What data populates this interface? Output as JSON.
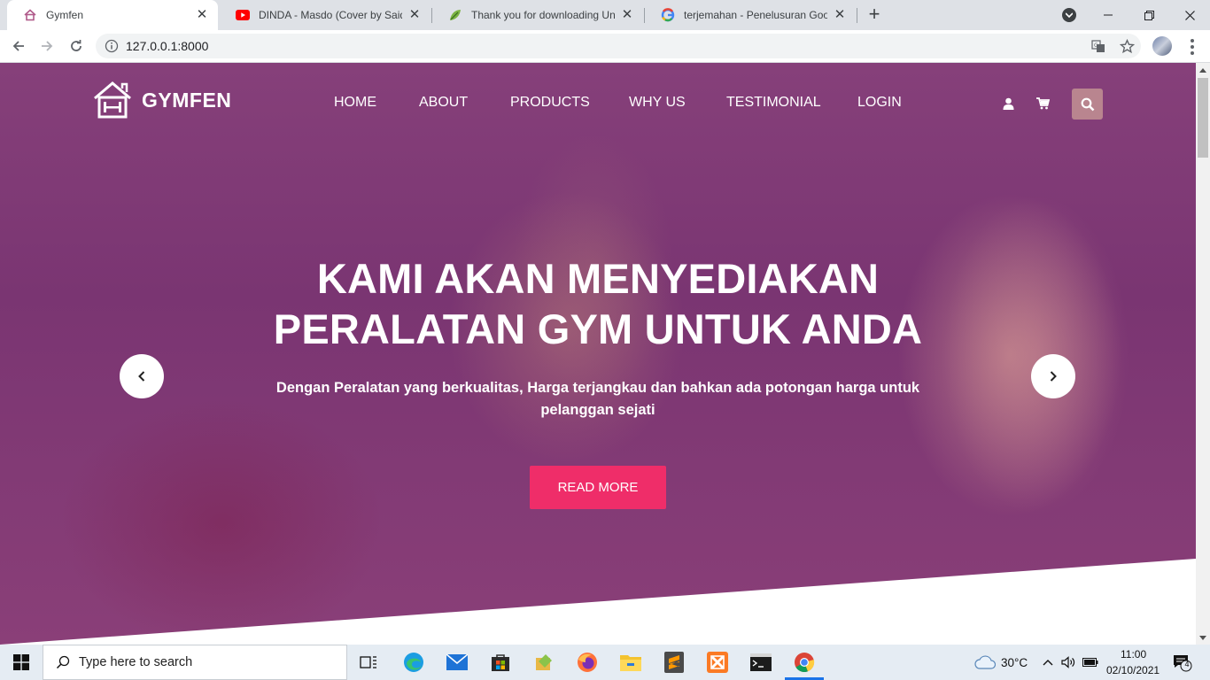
{
  "browser": {
    "tabs": [
      {
        "title": "Gymfen",
        "favicon": "house-icon",
        "active": true
      },
      {
        "title": "DINDA - Masdo (Cover by Saidah",
        "favicon": "youtube-icon",
        "active": false
      },
      {
        "title": "Thank you for downloading Unlo",
        "favicon": "leaf-icon",
        "active": false
      },
      {
        "title": "terjemahan - Penelusuran Google",
        "favicon": "google-icon",
        "active": false
      }
    ],
    "new_tab_label": "+",
    "url": "127.0.0.1:8000"
  },
  "site": {
    "brand": "GYMFEN",
    "nav": [
      "HOME",
      "ABOUT",
      "PRODUCTS",
      "WHY US",
      "TESTIMONIAL",
      "LOGIN"
    ],
    "hero": {
      "title_line1": "KAMI AKAN MENYEDIAKAN",
      "title_line2": "PERALATAN GYM UNTUK ANDA",
      "subtitle": "Dengan Peralatan yang berkualitas, Harga terjangkau dan bahkan ada potongan harga untuk pelanggan sejati",
      "cta": "READ MORE"
    },
    "colors": {
      "overlay": "#7a3572",
      "cta": "#ef2d69",
      "search_btn": "#b9858f"
    }
  },
  "taskbar": {
    "search_placeholder": "Type here to search",
    "weather": "30°C",
    "time": "11:00",
    "date": "02/10/2021",
    "notifications": "4"
  }
}
